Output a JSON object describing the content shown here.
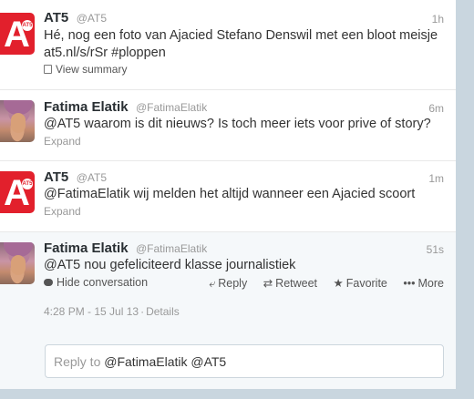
{
  "tweets": [
    {
      "name": "AT5",
      "handle": "@AT5",
      "time": "1h",
      "text": "Hé, nog een foto van Ajacied Stefano Denswil met een bloot meisje",
      "link": "at5.nl/s/rSr",
      "hashtag": "#ploppen",
      "summary": "View summary"
    },
    {
      "name": "Fatima Elatik",
      "handle": "@FatimaElatik",
      "time": "6m",
      "mention": "@AT5",
      "text": "waarom is dit nieuws? Is toch meer iets voor prive of story?",
      "expand": "Expand"
    },
    {
      "name": "AT5",
      "handle": "@AT5",
      "time": "1m",
      "mention": "@FatimaElatik",
      "text": "wij melden het altijd wanneer een Ajacied scoort",
      "expand": "Expand"
    },
    {
      "name": "Fatima Elatik",
      "handle": "@FatimaElatik",
      "time": "51s",
      "mention": "@AT5",
      "text": "nou gefeliciteerd klasse journalistiek",
      "hide": "Hide conversation",
      "actions": {
        "reply": "Reply",
        "retweet": "Retweet",
        "favorite": "Favorite",
        "more": "More"
      },
      "datetime": "4:28 PM - 15 Jul 13",
      "details": "Details"
    }
  ],
  "reply_box": {
    "prefix": "Reply to",
    "names": "@FatimaElatik @AT5"
  },
  "colors": {
    "brand_red": "#e2202c",
    "background": "#c9d6df"
  },
  "icons": [
    "summary-icon",
    "bubble-icon",
    "reply-icon",
    "retweet-icon",
    "favorite-icon",
    "more-icon"
  ]
}
